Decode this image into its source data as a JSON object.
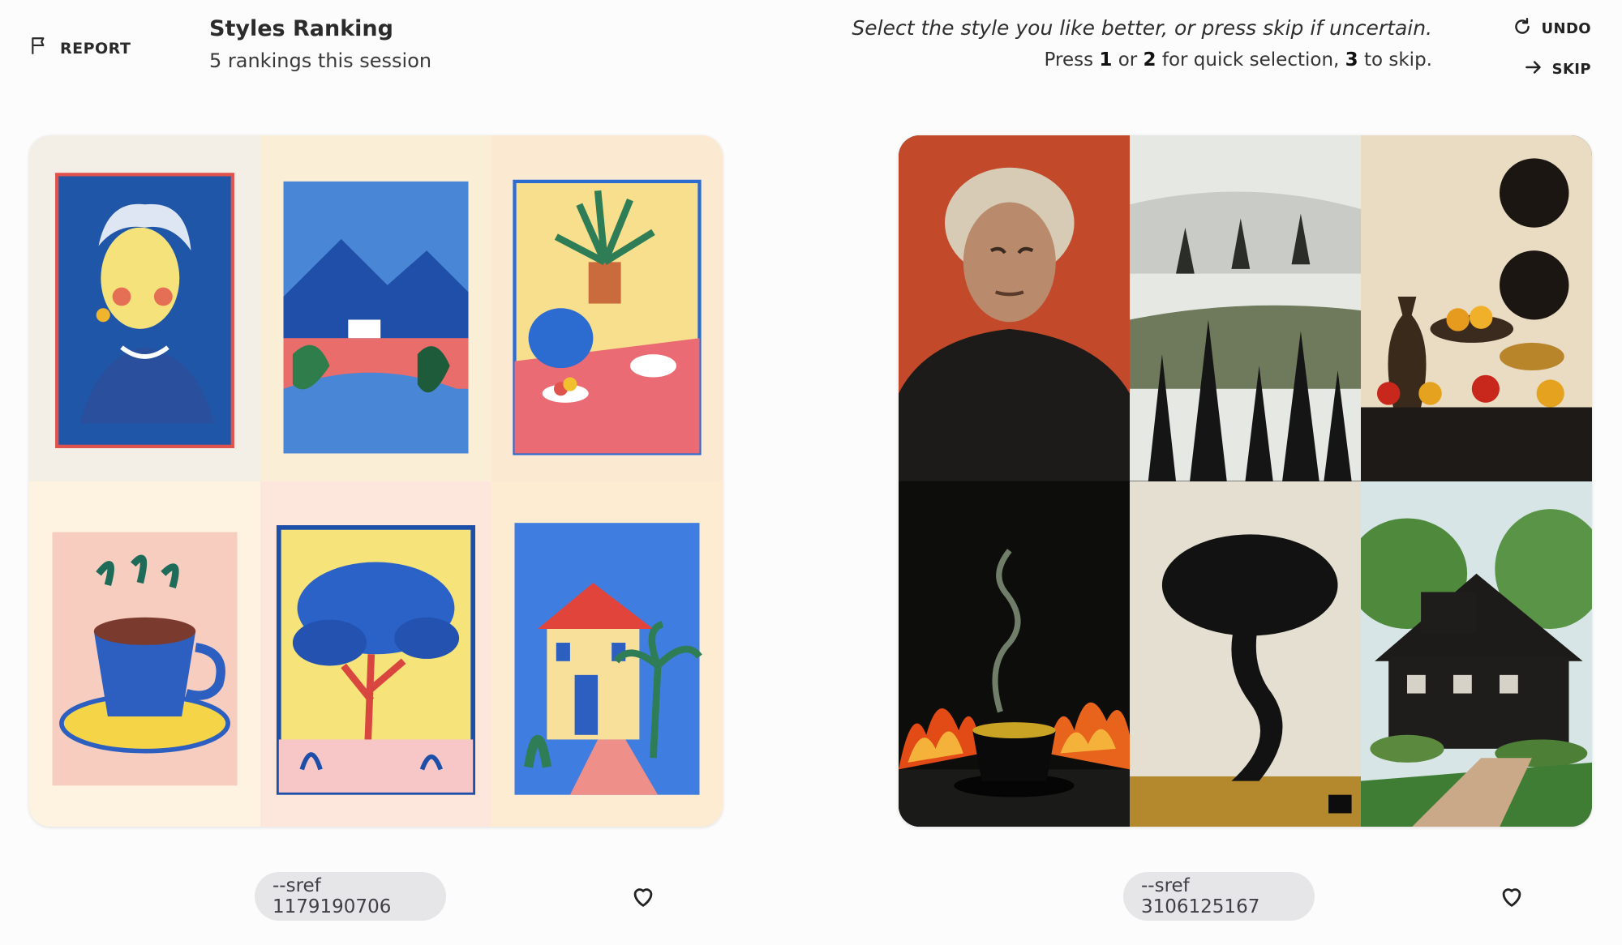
{
  "header": {
    "report_label": "REPORT",
    "title": "Styles Ranking",
    "subtitle": "5 rankings this session",
    "instruction_line1": "Select the style you like better, or press skip if uncertain.",
    "instruction_line2_parts": [
      "Press ",
      "1",
      " or ",
      "2",
      " for quick selection, ",
      "3",
      " to skip."
    ],
    "undo_label": "UNDO",
    "skip_label": "SKIP"
  },
  "options": [
    {
      "sref_label": "--sref 1179190706",
      "tiles": [
        "portrait-woman",
        "mountain-landscape",
        "teapot-still-life",
        "coffee-cup",
        "blue-tree",
        "villa-with-palms"
      ]
    },
    {
      "sref_label": "--sref 3106125167",
      "tiles": [
        "portrait-man",
        "misty-forest",
        "fruit-still-life",
        "tea-cup-flames",
        "tree-silhouette",
        "dark-house"
      ]
    }
  ],
  "icons": {
    "report": "flag-icon",
    "undo": "rotate-icon",
    "skip": "arrow-right-icon",
    "favorite": "heart-icon"
  },
  "colors": {
    "background": "#fcfcfc",
    "pill_bg": "#e6e6e8",
    "text": "#2b2b2b"
  }
}
